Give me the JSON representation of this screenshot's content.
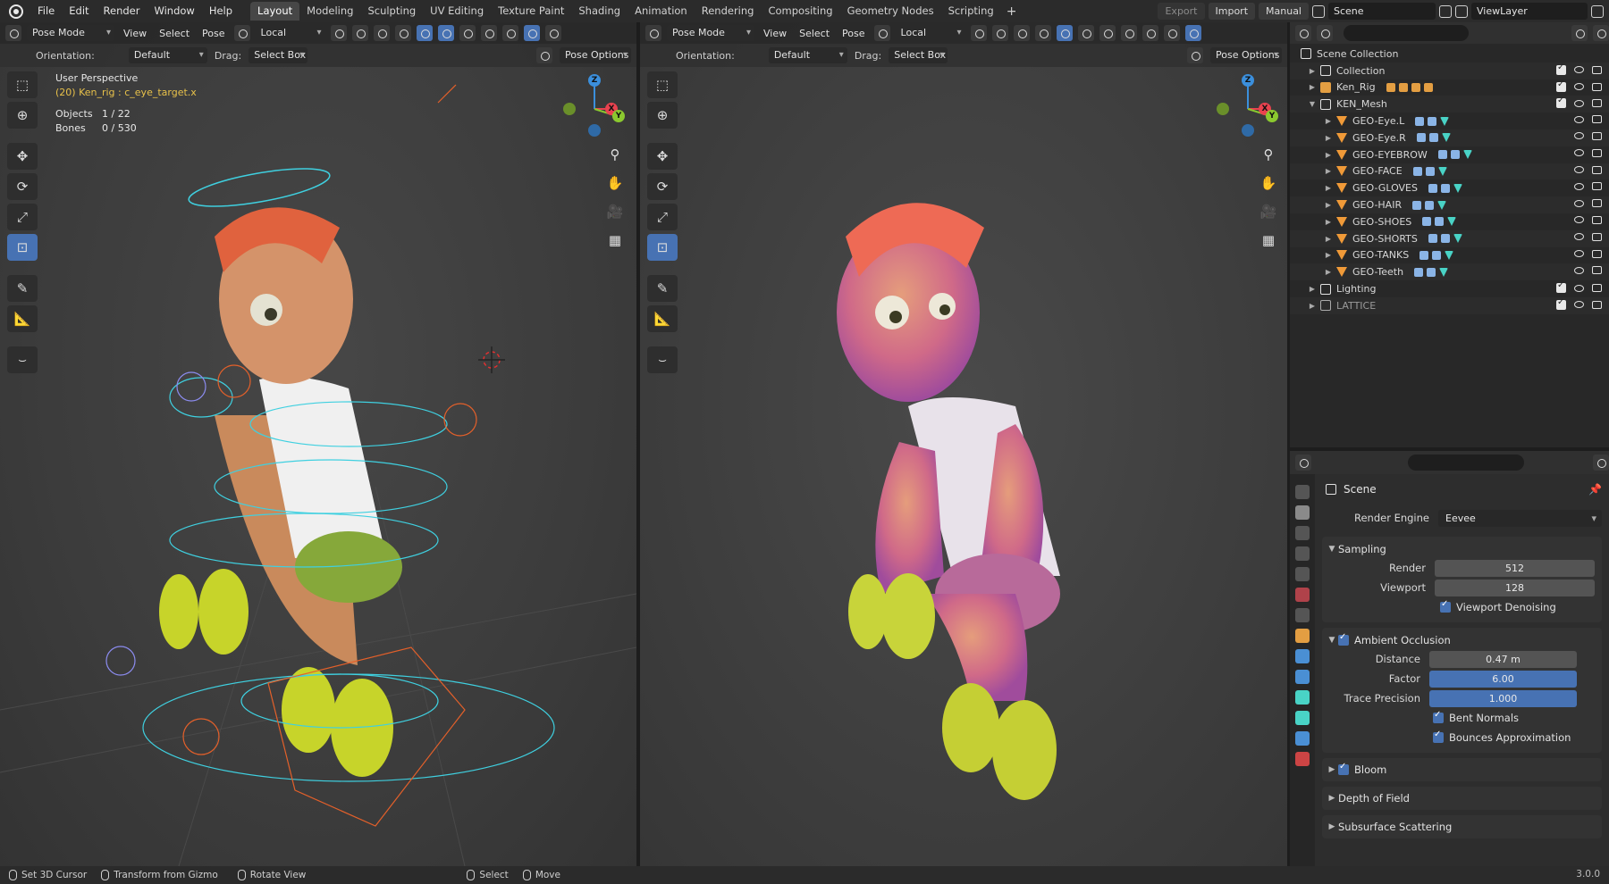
{
  "topbar": {
    "menu": [
      "File",
      "Edit",
      "Render",
      "Window",
      "Help"
    ],
    "workspaces": [
      "Layout",
      "Modeling",
      "Sculpting",
      "UV Editing",
      "Texture Paint",
      "Shading",
      "Animation",
      "Rendering",
      "Compositing",
      "Geometry Nodes",
      "Scripting"
    ],
    "active_workspace": "Layout",
    "add_label": "+",
    "export_label": "Export",
    "import_label": "Import",
    "manual_label": "Manual",
    "scene_name": "Scene",
    "view_layer": "ViewLayer"
  },
  "viewport_left": {
    "mode": "Pose Mode",
    "menus": [
      "View",
      "Select",
      "Pose"
    ],
    "transform_space": "Local",
    "orientation_label": "Orientation:",
    "orientation_value": "Default",
    "drag_label": "Drag:",
    "drag_value": "Select Box",
    "pose_options": "Pose Options",
    "overlay_title": "User Perspective",
    "overlay_context": "(20) Ken_rig : c_eye_target.x",
    "objects_label": "Objects",
    "objects_value": "1 / 22",
    "bones_label": "Bones",
    "bones_value": "0 / 530"
  },
  "viewport_right": {
    "mode": "Pose Mode",
    "menus": [
      "View",
      "Select",
      "Pose"
    ],
    "transform_space": "Local",
    "orientation_label": "Orientation:",
    "orientation_value": "Default",
    "drag_label": "Drag:",
    "drag_value": "Select Box",
    "pose_options": "Pose Options"
  },
  "gizmo_axes": {
    "z": "Z",
    "x": "X",
    "y": "Y"
  },
  "outliner": {
    "root": "Scene Collection",
    "rows": [
      {
        "name": "Collection",
        "type": "coll",
        "indent": 1
      },
      {
        "name": "Ken_Rig",
        "type": "arm",
        "indent": 1
      },
      {
        "name": "KEN_Mesh",
        "type": "coll",
        "indent": 1,
        "open": true
      },
      {
        "name": "GEO-Eye.L",
        "type": "mesh",
        "indent": 2
      },
      {
        "name": "GEO-Eye.R",
        "type": "mesh",
        "indent": 2
      },
      {
        "name": "GEO-EYEBROW",
        "type": "mesh",
        "indent": 2
      },
      {
        "name": "GEO-FACE",
        "type": "mesh",
        "indent": 2
      },
      {
        "name": "GEO-GLOVES",
        "type": "mesh",
        "indent": 2
      },
      {
        "name": "GEO-HAIR",
        "type": "mesh",
        "indent": 2
      },
      {
        "name": "GEO-SHOES",
        "type": "mesh",
        "indent": 2
      },
      {
        "name": "GEO-SHORTS",
        "type": "mesh",
        "indent": 2
      },
      {
        "name": "GEO-TANKS",
        "type": "mesh",
        "indent": 2
      },
      {
        "name": "GEO-Teeth",
        "type": "mesh",
        "indent": 2
      },
      {
        "name": "Lighting",
        "type": "coll",
        "indent": 1
      },
      {
        "name": "LATTICE",
        "type": "latt",
        "indent": 1
      }
    ]
  },
  "properties": {
    "context": "Scene",
    "render_engine_label": "Render Engine",
    "render_engine": "Eevee",
    "sampling": {
      "title": "Sampling",
      "render_label": "Render",
      "render_value": "512",
      "viewport_label": "Viewport",
      "viewport_value": "128",
      "denoise_label": "Viewport Denoising"
    },
    "ao": {
      "title": "Ambient Occlusion",
      "distance_label": "Distance",
      "distance_value": "0.47 m",
      "factor_label": "Factor",
      "factor_value": "6.00",
      "trace_label": "Trace Precision",
      "trace_value": "1.000",
      "bent_label": "Bent Normals",
      "bounces_label": "Bounces Approximation"
    },
    "bloom": "Bloom",
    "dof": "Depth of Field",
    "sss": "Subsurface Scattering"
  },
  "statusbar": {
    "items": [
      "Set 3D Cursor",
      "Transform from Gizmo",
      "Rotate View",
      "Select",
      "Move"
    ],
    "version": "3.0.0"
  },
  "colors": {
    "accent": "#4772b3",
    "header_bg": "#2b2b2b",
    "viewport_bg": "#3d3d3d",
    "active_text": "#e8c14a",
    "gizmo_x": "#e9424f",
    "gizmo_y": "#8bc92f",
    "gizmo_z": "#3b8fdc",
    "rig_cyan": "#3fd0e0",
    "rig_orange": "#e4602a",
    "character_skin": "#c98a5c",
    "hair": "#e0623e",
    "gloves_shoes": "#c7d42a"
  }
}
